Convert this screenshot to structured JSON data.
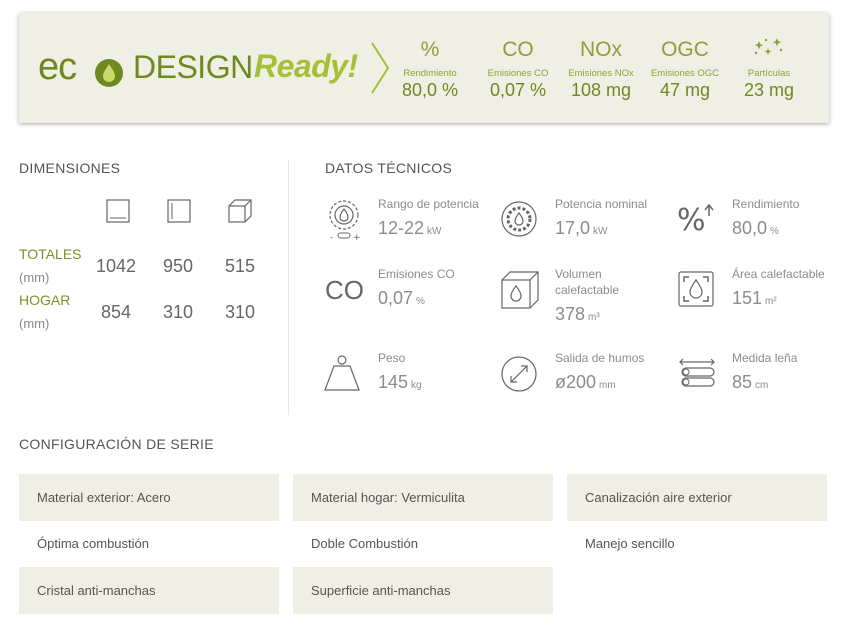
{
  "banner": {
    "logo": {
      "eco": "ec",
      "design": "DESIGN",
      "ready": "Ready!"
    },
    "stats": [
      {
        "symbol": "%",
        "label": "Rendimiento",
        "value": "80,0 %"
      },
      {
        "symbol": "CO",
        "label": "Emisiones CO",
        "value": "0,07 %"
      },
      {
        "symbol": "NOx",
        "label": "Emisiones NOx",
        "value": "108 mg"
      },
      {
        "symbol": "OGC",
        "label": "Emisiones OGC",
        "value": "47 mg"
      },
      {
        "symbol": "particles-icon",
        "label": "Partículas",
        "value": "23 mg"
      }
    ]
  },
  "dimensions": {
    "title": "DIMENSIONES",
    "icons": [
      "width-icon",
      "height-icon",
      "depth-icon"
    ],
    "rows": [
      {
        "label": "TOTALES",
        "unit": "(mm)",
        "values": [
          "1042",
          "950",
          "515"
        ]
      },
      {
        "label": "HOGAR",
        "unit": "(mm)",
        "values": [
          "854",
          "310",
          "310"
        ]
      }
    ]
  },
  "tech": {
    "title": "DATOS TÉCNICOS",
    "items": [
      {
        "icon": "power-range-icon",
        "label": "Rango de potencia",
        "value": "12-22",
        "unit": "kW"
      },
      {
        "icon": "nominal-power-icon",
        "label": "Potencia nominal",
        "value": "17,0",
        "unit": "kW"
      },
      {
        "icon": "efficiency-icon",
        "label": "Rendimiento",
        "value": "80,0",
        "unit": "%"
      },
      {
        "icon": "co-icon",
        "icon_text": "CO",
        "label": "Emisiones CO",
        "value": "0,07",
        "unit": "%"
      },
      {
        "icon": "heated-volume-icon",
        "label_line1": "Volumen",
        "label_line2": "calefactable",
        "value": "378",
        "unit": "m³"
      },
      {
        "icon": "heated-area-icon",
        "label": "Área calefactable",
        "value": "151",
        "unit": "m²"
      },
      {
        "icon": "weight-icon",
        "label": "Peso",
        "value": "145",
        "unit": "kg"
      },
      {
        "icon": "flue-outlet-icon",
        "label": "Salida de humos",
        "value": "ø200",
        "unit": "mm"
      },
      {
        "icon": "log-length-icon",
        "label": "Medida leña",
        "value": "85",
        "unit": "cm"
      }
    ]
  },
  "config": {
    "title": "CONFIGURACIÓN DE SERIE",
    "items": [
      "Material exterior: Acero",
      "Material hogar: Vermiculita",
      "Canalización aire exterior",
      "Óptima combustión",
      "Doble Combustión",
      "Manejo sencillo",
      "Cristal anti-manchas",
      "Superficie anti-manchas"
    ]
  },
  "colors": {
    "brand_dark": "#6e8a1e",
    "brand_light": "#a6c036",
    "panel_bg": "#f0efe6"
  }
}
